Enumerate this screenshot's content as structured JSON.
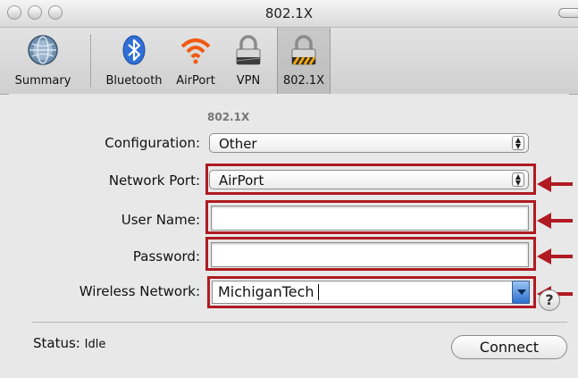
{
  "window": {
    "title": "802.1X"
  },
  "toolbar": {
    "items": [
      {
        "label": "Summary",
        "icon": "globe-icon"
      },
      {
        "label": "Bluetooth",
        "icon": "bluetooth-icon"
      },
      {
        "label": "AirPort",
        "icon": "airport-wifi-icon"
      },
      {
        "label": "VPN",
        "icon": "lock-icon"
      },
      {
        "label": "802.1X",
        "icon": "lock-hazard-icon",
        "selected": true
      }
    ]
  },
  "form": {
    "section_title": "802.1X",
    "configuration": {
      "label": "Configuration:",
      "value": "Other"
    },
    "network_port": {
      "label": "Network Port:",
      "value": "AirPort"
    },
    "user_name": {
      "label": "User Name:",
      "value": ""
    },
    "password": {
      "label": "Password:",
      "value": ""
    },
    "wireless_network": {
      "label": "Wireless Network:",
      "value": "MichiganTech"
    }
  },
  "status": {
    "label": "Status:",
    "value": "Idle"
  },
  "buttons": {
    "connect": "Connect",
    "help": "?"
  },
  "colors": {
    "highlight": "#b01a22",
    "accent_blue": "#2a6fd0"
  }
}
